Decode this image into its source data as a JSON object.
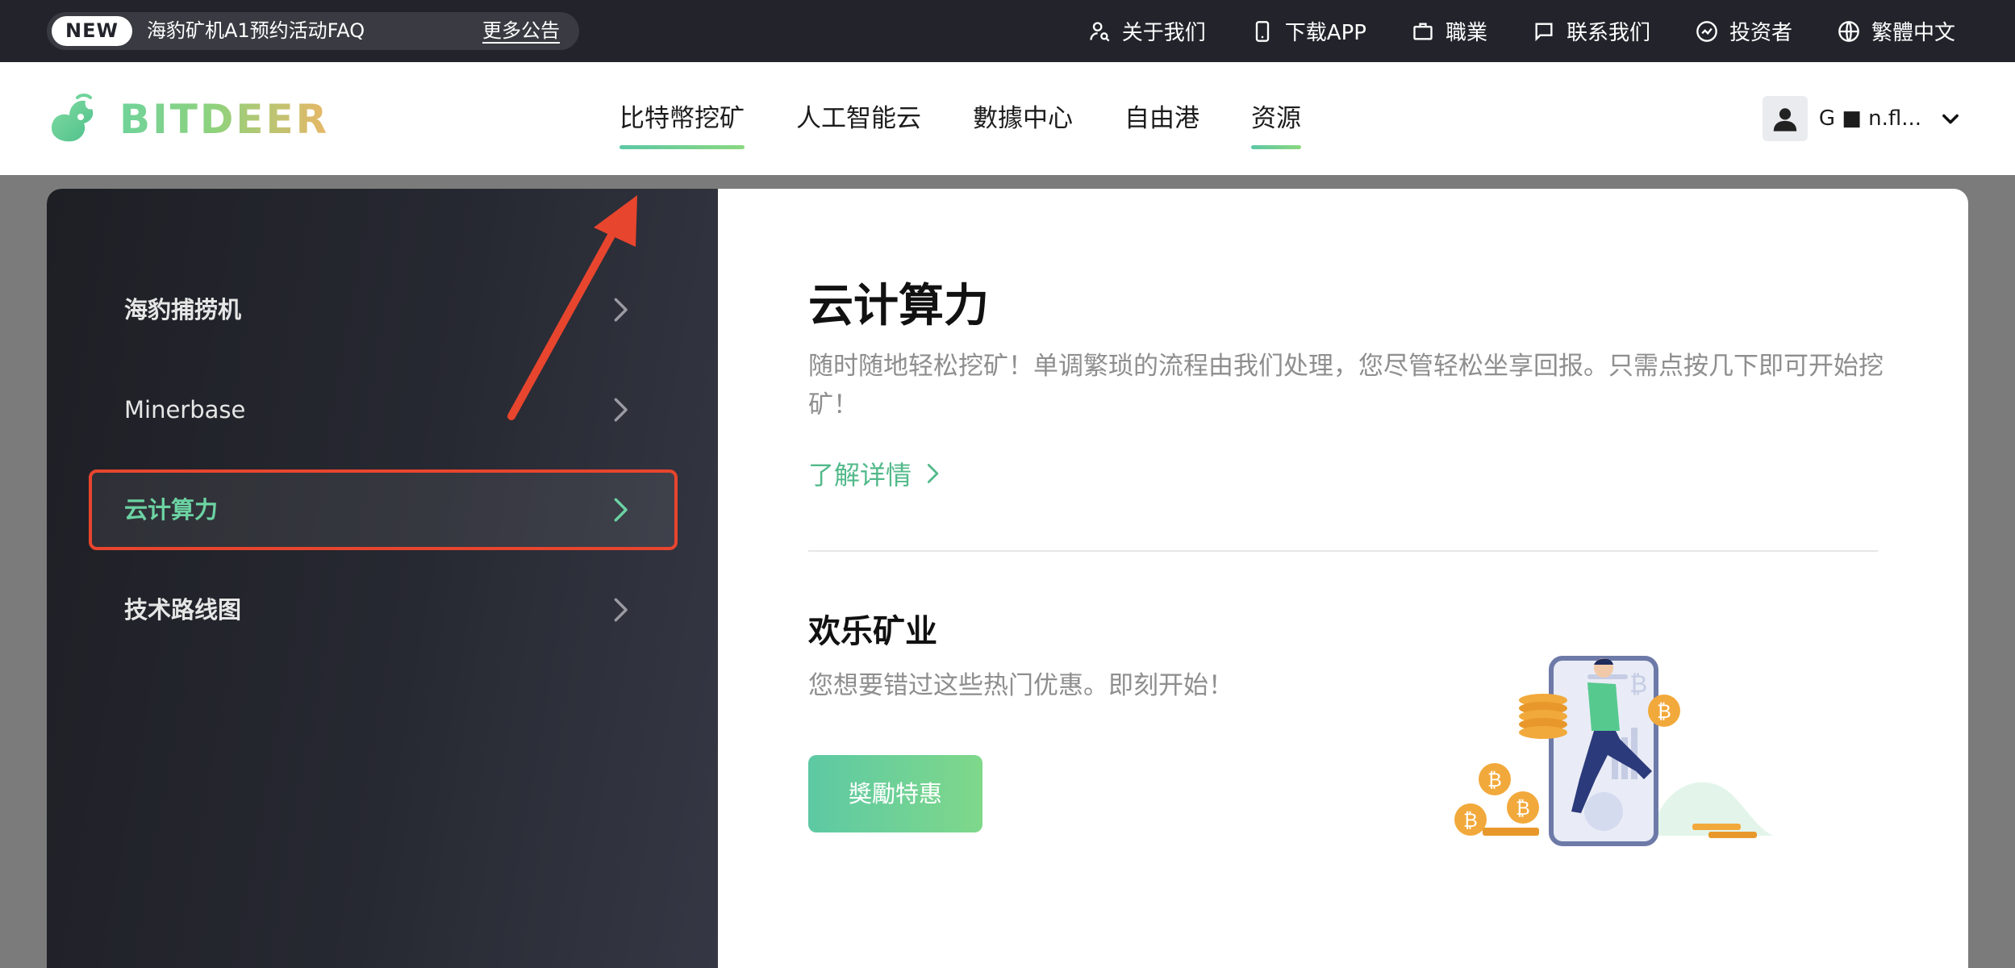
{
  "announcement": {
    "badge": "NEW",
    "text": "海豹矿机A1预约活动FAQ",
    "more": "更多公告"
  },
  "top_links": [
    {
      "label": "关于我们",
      "icon": "user-search-icon"
    },
    {
      "label": "下载APP",
      "icon": "phone-icon"
    },
    {
      "label": "職業",
      "icon": "briefcase-icon"
    },
    {
      "label": "联系我们",
      "icon": "chat-icon"
    },
    {
      "label": "投资者",
      "icon": "chart-circle-icon"
    },
    {
      "label": "繁體中文",
      "icon": "globe-icon"
    }
  ],
  "brand": {
    "name": "BITDEER"
  },
  "nav": [
    {
      "label": "比特幣挖矿",
      "active": true
    },
    {
      "label": "人工智能云",
      "active": false
    },
    {
      "label": "數據中心",
      "active": false
    },
    {
      "label": "自由港",
      "active": false
    },
    {
      "label": "资源",
      "active": true
    }
  ],
  "user": {
    "name": "G   ■  n.fl..."
  },
  "sidebar": {
    "items": [
      {
        "label": "海豹捕捞机"
      },
      {
        "label": "Minerbase"
      },
      {
        "label": "云计算力"
      },
      {
        "label": "技术路线图"
      }
    ],
    "active_index": 2
  },
  "content": {
    "title": "云计算力",
    "description": "随时随地轻松挖矿！单调繁琐的流程由我们处理，您尽管轻松坐享回报。只需点按几下即可开始挖矿！",
    "link": "了解详情",
    "sub_title": "欢乐矿业",
    "sub_description": "您想要错过这些热门优惠。即刻开始！",
    "button": "獎勵特惠"
  },
  "colors": {
    "accent": "#5cc7a5",
    "highlight_border": "#e8452e",
    "topbar": "#23242b"
  }
}
